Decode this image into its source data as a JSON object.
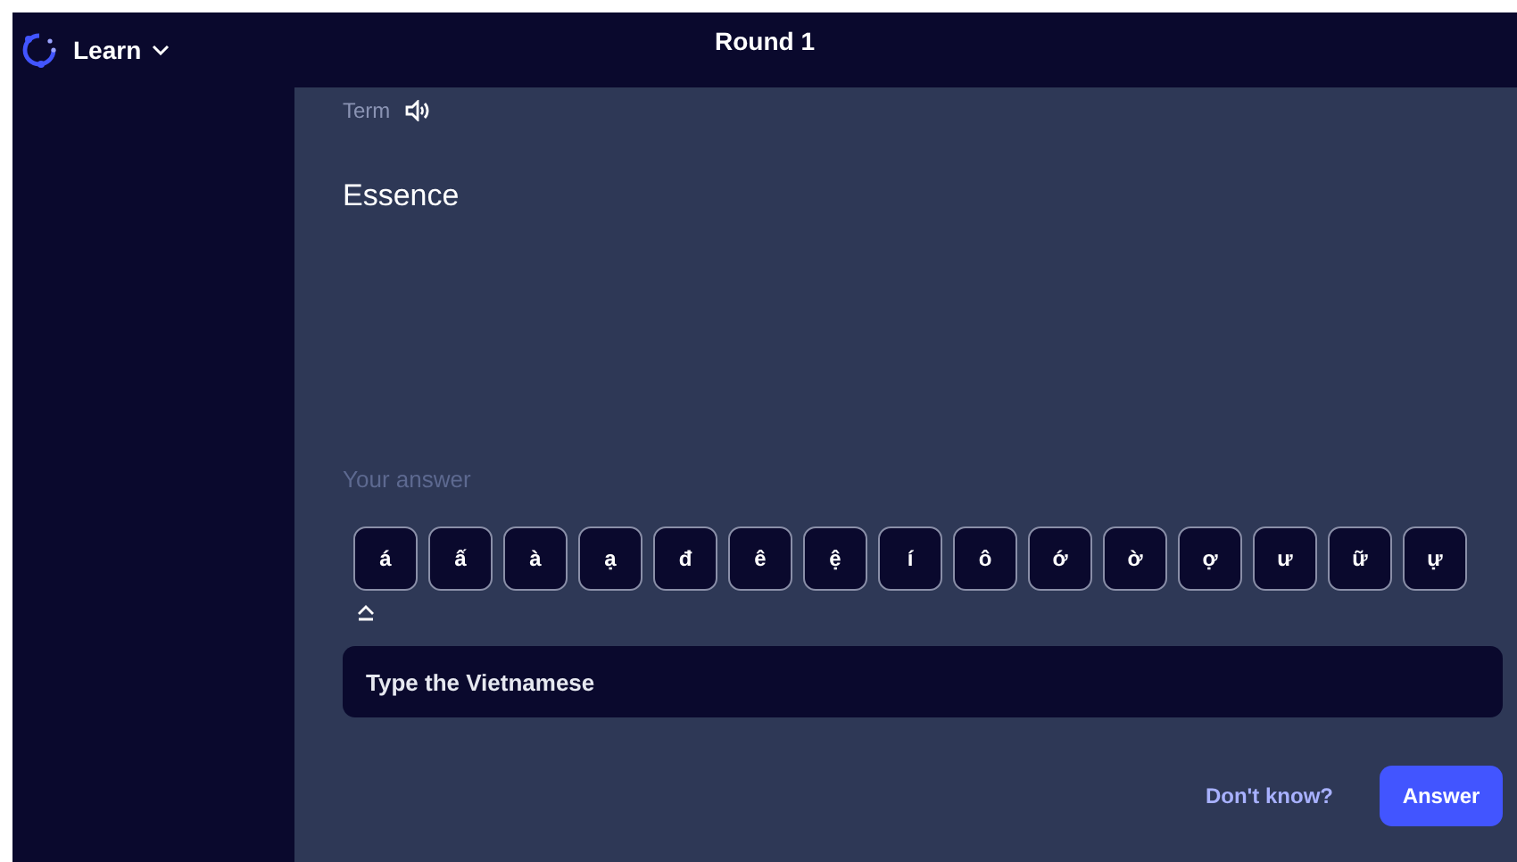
{
  "header": {
    "menu_label": "Learn",
    "title": "Round 1"
  },
  "term": {
    "label": "Term",
    "text": "Essence"
  },
  "answer": {
    "label": "Your answer",
    "placeholder": "Type the Vietnamese"
  },
  "accent_keys": [
    "á",
    "ấ",
    "à",
    "ạ",
    "đ",
    "ê",
    "ệ",
    "í",
    "ô",
    "ớ",
    "ờ",
    "ợ",
    "ư",
    "ữ",
    "ự"
  ],
  "actions": {
    "dont_know": "Don't know?",
    "submit": "Answer"
  }
}
